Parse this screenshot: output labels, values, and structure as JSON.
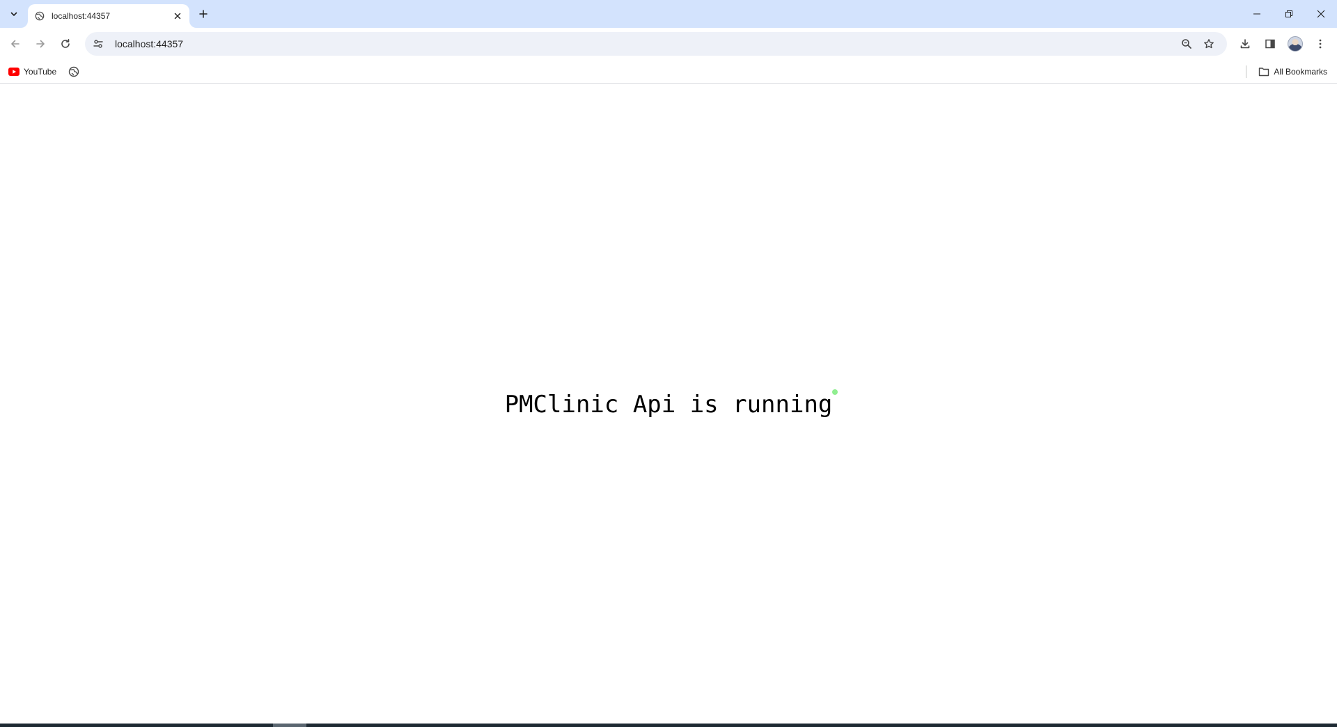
{
  "browser": {
    "tab": {
      "title": "localhost:44357"
    },
    "address_bar": {
      "url": "localhost:44357"
    },
    "bookmarks": [
      {
        "label": "YouTube",
        "icon": "youtube-icon"
      },
      {
        "label": "",
        "icon": "globe-icon"
      }
    ],
    "all_bookmarks_label": "All Bookmarks"
  },
  "page": {
    "status_text": "PMClinic Api is running",
    "status_dot_color": "#90ee90"
  },
  "colors": {
    "tabstrip": "#d3e3fd",
    "omnibox": "#eef1f8",
    "youtube_red": "#ff0000"
  }
}
